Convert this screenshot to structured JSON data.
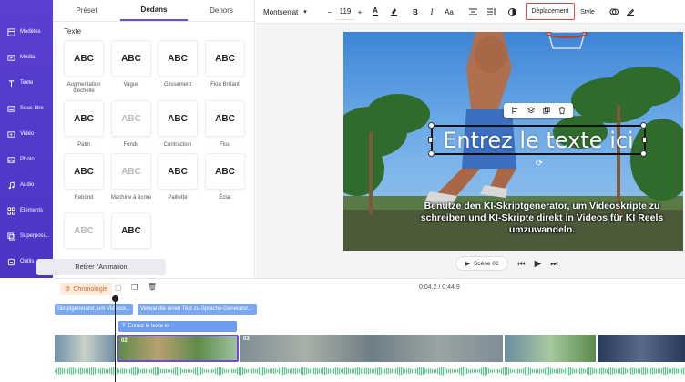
{
  "nav": {
    "items": [
      {
        "label": "Modèles",
        "icon": "layout-icon"
      },
      {
        "label": "Média",
        "icon": "media-icon"
      },
      {
        "label": "Texte",
        "icon": "text-icon"
      },
      {
        "label": "Sous-titre",
        "icon": "subtitle-icon"
      },
      {
        "label": "Vidéo",
        "icon": "video-icon"
      },
      {
        "label": "Photo",
        "icon": "photo-icon"
      },
      {
        "label": "Audio",
        "icon": "audio-icon"
      },
      {
        "label": "Eléments",
        "icon": "elements-icon"
      },
      {
        "label": "Superposi...",
        "icon": "overlay-icon"
      },
      {
        "label": "Outils",
        "icon": "tools-icon"
      }
    ]
  },
  "anim_panel": {
    "tabs": [
      "Préset",
      "Dedans",
      "Dehors"
    ],
    "active_tab": "Dedans",
    "section": "Texte",
    "cards": [
      {
        "label": "Augmentation d'échelle",
        "glyph": "ABC"
      },
      {
        "label": "Vague",
        "glyph": "ABC"
      },
      {
        "label": "Glissement",
        "glyph": "ABC"
      },
      {
        "label": "Flou Brillant",
        "glyph": "ABC"
      },
      {
        "label": "Patin",
        "glyph": "ABC"
      },
      {
        "label": "Fondu",
        "glyph": "ABC"
      },
      {
        "label": "Contraction",
        "glyph": "ABC"
      },
      {
        "label": "Flou",
        "glyph": "ABC"
      },
      {
        "label": "Rebond",
        "glyph": "ABC"
      },
      {
        "label": "Machine à écrire",
        "glyph": "ABC"
      },
      {
        "label": "Paillette",
        "glyph": "ABC"
      },
      {
        "label": "Éclat",
        "glyph": "ABC"
      },
      {
        "label": "",
        "glyph": "ABC"
      },
      {
        "label": "",
        "glyph": "ABC"
      }
    ],
    "remove_button": "Retirer l'Animation"
  },
  "toolbar": {
    "font": "Montserrat",
    "font_size": "119",
    "minus": "−",
    "plus": "+",
    "bold": "B",
    "italic": "I",
    "case": "Aa",
    "deplacement": "Déplacement",
    "style": "Style"
  },
  "canvas": {
    "text_box": "Entrez le texte ici",
    "subtitle": "Benutze den KI-Skriptgenerator, um Videoskripte zu schreiben und KI-Skripte direkt in Videos für KI Reels umzuwandeln.",
    "scene_label": "Scène 02"
  },
  "timeline": {
    "chrono_label": "Chronologie",
    "timecode": "0:04.2 / 0:44.9",
    "track1_a": "Skriptgenerator, um Videosk...",
    "track1_b": "Verwandle einen Text zu-Sprache-Generator...",
    "track2": "Entrez le texte ici",
    "clip2_label": "02",
    "clip3_label": "03"
  },
  "colors": {
    "nav_bg": "#5b3fd0",
    "accent": "#6a4ae8",
    "deplacement_border": "#e24a4a",
    "track_blue": "#7aa7ef",
    "chrono_bg": "#fdebdc"
  }
}
